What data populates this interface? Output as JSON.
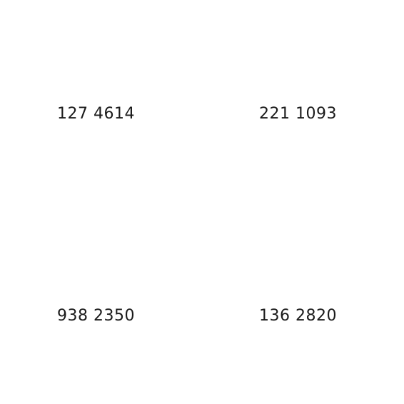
{
  "numbers": [
    "127 4614",
    "221 1093",
    "938 2350",
    "136 2820"
  ]
}
